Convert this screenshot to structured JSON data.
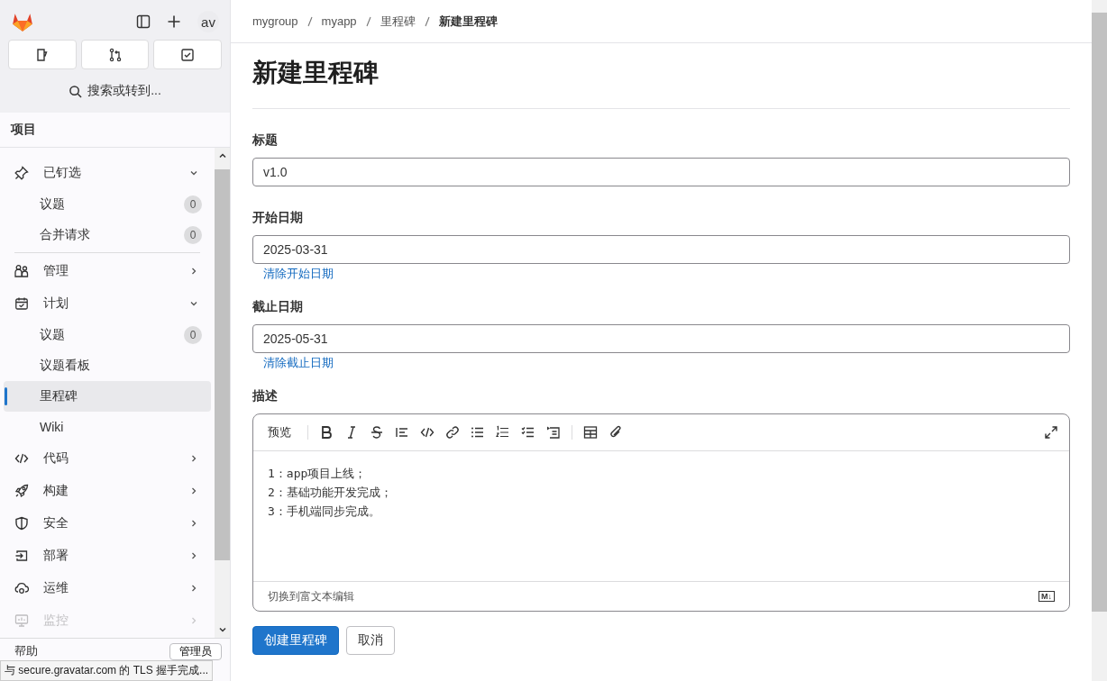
{
  "sidebar": {
    "avatar": "av",
    "search": {
      "placeholder": "搜索或转到..."
    },
    "section_title": "项目",
    "nav": [
      {
        "kind": "pinned",
        "label": "已钉选",
        "faded": false,
        "expanded": true,
        "children": [
          {
            "label": "议题",
            "badge": "0",
            "selected": false
          },
          {
            "label": "合并请求",
            "badge": "0",
            "selected": false
          }
        ]
      },
      {
        "kind": "group",
        "label": "管理",
        "faded": false,
        "expanded": false
      },
      {
        "kind": "group",
        "label": "计划",
        "faded": false,
        "expanded": true,
        "children": [
          {
            "label": "议题",
            "badge": "0",
            "selected": false
          },
          {
            "label": "议题看板",
            "selected": false
          },
          {
            "label": "里程碑",
            "selected": true
          },
          {
            "label": "Wiki",
            "selected": false
          }
        ]
      },
      {
        "kind": "group",
        "label": "代码",
        "faded": false,
        "expanded": false
      },
      {
        "kind": "group",
        "label": "构建",
        "faded": false,
        "expanded": false
      },
      {
        "kind": "group",
        "label": "安全",
        "faded": false,
        "expanded": false
      },
      {
        "kind": "group",
        "label": "部署",
        "faded": false,
        "expanded": false
      },
      {
        "kind": "group",
        "label": "运维",
        "faded": false,
        "expanded": false
      },
      {
        "kind": "group",
        "label": "监控",
        "faded": true,
        "expanded": false
      }
    ],
    "help": "帮助",
    "admin": "管理员"
  },
  "breadcrumbs": [
    {
      "label": "mygroup",
      "current": false
    },
    {
      "label": "myapp",
      "current": false
    },
    {
      "label": "里程碑",
      "current": false
    },
    {
      "label": "新建里程碑",
      "current": true
    }
  ],
  "title": "新建里程碑",
  "fields": [
    {
      "label": "标题",
      "value": "v1.0"
    },
    {
      "label": "开始日期",
      "value": "2025-03-31",
      "clear_link": "清除开始日期"
    },
    {
      "label": "截止日期",
      "value": "2025-05-31",
      "clear_link": "清除截止日期"
    }
  ],
  "description": {
    "label": "描述",
    "preview_tab": "预览",
    "lines": [
      "1：app项目上线；",
      "2：基础功能开发完成；",
      "3：手机端同步完成。"
    ],
    "switch_link": "切换到富文本编辑",
    "markdown_badge": "M↓"
  },
  "buttons": {
    "submit": "创建里程碑",
    "cancel": "取消"
  },
  "status_bar": "与 secure.gravatar.com 的 TLS 握手完成..."
}
